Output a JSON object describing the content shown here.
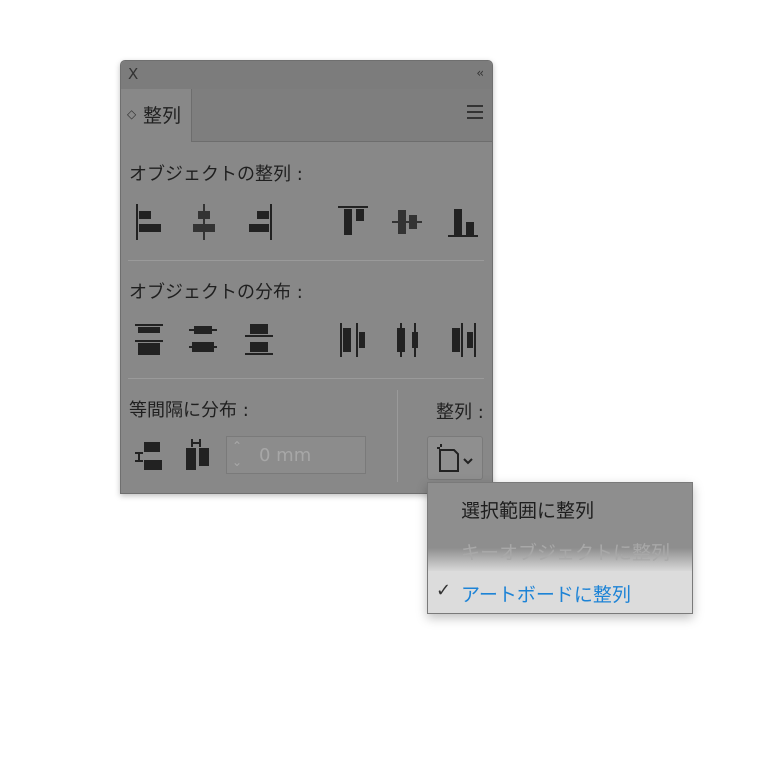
{
  "panel": {
    "close_glyph": "X",
    "collapse_glyph": "‹‹",
    "tab": {
      "arrows": "◇",
      "label": "整列"
    },
    "sections": {
      "align_objects": "オブジェクトの整列 :",
      "distribute_objects": "オブジェクトの分布 :",
      "distribute_spacing": "等間隔に分布 :",
      "align_to": "整列 :"
    },
    "spacing": {
      "value": "0 mm",
      "arrows": "⌃⌄"
    }
  },
  "align_to_menu": {
    "items": [
      {
        "label": "選択範囲に整列",
        "state": "enabled"
      },
      {
        "label": "キーオブジェクトに整列",
        "state": "disabled"
      },
      {
        "label": "アートボードに整列",
        "state": "checked"
      }
    ],
    "check_glyph": "✓",
    "selected_color": "#1d83d6"
  },
  "icons": {
    "align_objects": [
      "align-left-edge-icon",
      "align-horizontal-center-icon",
      "align-right-edge-icon",
      "align-top-edge-icon",
      "align-vertical-center-icon",
      "align-bottom-edge-icon"
    ],
    "distribute_objects": [
      "distribute-top-edge-icon",
      "distribute-vertical-center-icon",
      "distribute-bottom-edge-icon",
      "distribute-left-edge-icon",
      "distribute-horizontal-center-icon",
      "distribute-right-edge-icon"
    ],
    "distribute_spacing": [
      "vertical-distribute-space-icon",
      "horizontal-distribute-space-icon"
    ],
    "align_to": "align-to-artboard-icon"
  }
}
